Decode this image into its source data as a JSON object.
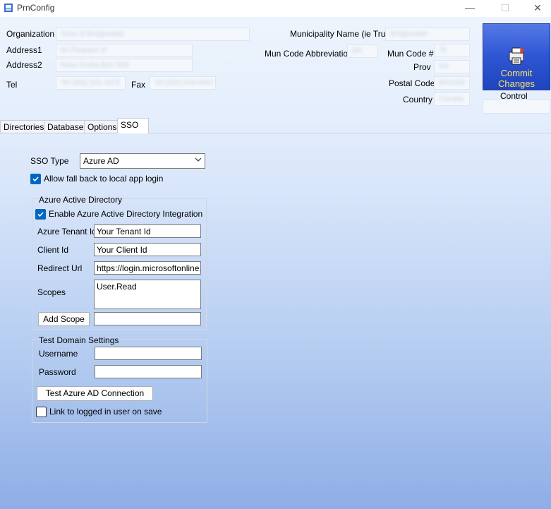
{
  "window": {
    "title": "PrnConfig",
    "minimize_glyph": "—",
    "maximize_glyph": "☐",
    "close_glyph": "✕"
  },
  "header": {
    "organization_label": "Organization",
    "organization_value": "Town of Bridgewater",
    "address1_label": "Address1",
    "address1_value": "60 Pleasant St",
    "address2_label": "Address2",
    "address2_value": "Nova Scotia B4V 3X9",
    "tel_label": "Tel",
    "tel_value": "Tel (902) 541-4378",
    "fax_label": "Fax",
    "fax_value": "Tel (902) 543-0467",
    "municipality_label": "Municipality Name (ie Truro)",
    "municipality_value": "Bridgewater",
    "mun_code_abbrev_label": "Mun Code Abbreviation",
    "mun_code_abbrev_value": "BR",
    "mun_code_label": "Mun Code #",
    "mun_code_value": "75",
    "prov_label": "Prov",
    "prov_value": "NS",
    "postal_label": "Postal Code",
    "postal_value": "B4V3X9",
    "country_label": "Country",
    "country_value": "Canada",
    "commit_line1": "Commit",
    "commit_line2": "Changes",
    "control_label": "Control"
  },
  "tabs": [
    {
      "label": "Directories",
      "active": false
    },
    {
      "label": "Database",
      "active": false
    },
    {
      "label": "Options",
      "active": false
    },
    {
      "label": "SSO",
      "active": true
    }
  ],
  "sso": {
    "type_label": "SSO Type",
    "type_value": "Azure AD",
    "fallback_label": "Allow fall back to local app login",
    "fallback_checked": true,
    "azure": {
      "group_title": "Azure Active Directory",
      "enable_label": "Enable Azure Active Directory Integration",
      "enable_checked": true,
      "tenant_label": "Azure Tenant Id",
      "tenant_value": "Your Tenant Id",
      "client_label": "Client Id",
      "client_value": "Your Client Id",
      "redirect_label": "Redirect Url",
      "redirect_value": "https://login.microsoftonline.com",
      "scopes_label": "Scopes",
      "scopes_value": "User.Read",
      "add_scope_label": "Add Scope",
      "new_scope_value": ""
    },
    "test": {
      "group_title": "Test Domain Settings",
      "username_label": "Username",
      "username_value": "",
      "password_label": "Password",
      "password_value": "",
      "test_button_label": "Test Azure AD Connection",
      "link_label": "Link to logged in user on save",
      "link_checked": false
    }
  },
  "colors": {
    "commit_bg": "#2e55d2",
    "commit_text": "#ffe35a",
    "checkbox_accent": "#0067c0"
  }
}
